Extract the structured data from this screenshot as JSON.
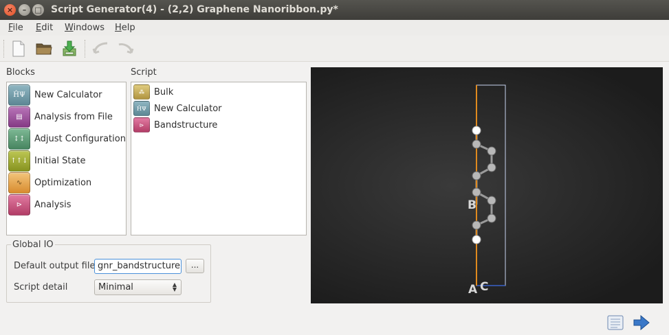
{
  "window": {
    "title": "Script Generator(4) - (2,2) Graphene Nanoribbon.py*",
    "close_glyph": "×",
    "minimize_glyph": "–",
    "maximize_glyph": "□"
  },
  "menu": {
    "items": [
      {
        "label": "File",
        "mnemonic": "F",
        "rest": "ile"
      },
      {
        "label": "Edit",
        "mnemonic": "E",
        "rest": "dit"
      },
      {
        "label": "Windows",
        "mnemonic": "W",
        "rest": "indows"
      },
      {
        "label": "Help",
        "mnemonic": "H",
        "rest": "elp"
      }
    ]
  },
  "toolbar": {
    "buttons": [
      {
        "icon": "new-file-icon"
      },
      {
        "icon": "open-folder-icon"
      },
      {
        "icon": "save-download-icon"
      },
      {
        "icon": "undo-icon",
        "disabled": true
      },
      {
        "icon": "redo-icon",
        "disabled": true
      }
    ]
  },
  "blocks": {
    "label": "Blocks",
    "items": [
      {
        "label": "New Calculator",
        "icon": "calculator-icon",
        "icon_text": "ĤΨ",
        "color": "#6f9aa7"
      },
      {
        "label": "Analysis from File",
        "icon": "file-icon",
        "icon_text": "▤",
        "color": "#9b4f9b"
      },
      {
        "label": "Adjust Configuration",
        "icon": "adjust-icon",
        "icon_text": "↕↕",
        "color": "#5a9a73"
      },
      {
        "label": "Initial State",
        "icon": "initial-state-icon",
        "icon_text": "↑↑↓",
        "color": "#9aa62f"
      },
      {
        "label": "Optimization",
        "icon": "optimization-icon",
        "icon_text": "∿",
        "color": "#e0a24a"
      },
      {
        "label": "Analysis",
        "icon": "analysis-icon",
        "icon_text": "⊳",
        "color": "#c9507a"
      }
    ]
  },
  "script": {
    "label": "Script",
    "items": [
      {
        "label": "Bulk",
        "icon": "bulk-icon",
        "icon_text": "⁂",
        "color": "#c9b05a"
      },
      {
        "label": "New Calculator",
        "icon": "calculator-icon",
        "icon_text": "ĤΨ",
        "color": "#6f9aa7"
      },
      {
        "label": "Bandstructure",
        "icon": "bandstructure-icon",
        "icon_text": "⊳",
        "color": "#c9507a"
      }
    ]
  },
  "global_io": {
    "title": "Global IO",
    "output_label": "Default output file",
    "output_value": "gnr_bandstructure.n",
    "browse_label": "...",
    "detail_label": "Script detail",
    "detail_value": "Minimal"
  },
  "viewer": {
    "axis_labels": {
      "a": "A",
      "b": "B",
      "c": "C"
    },
    "colors": {
      "a_axis": "#e08a1e",
      "cell": "#c8d4f0",
      "atom": "#bdbdbd",
      "hydrogen": "#ffffff"
    }
  },
  "bottom": {
    "buttons": [
      {
        "icon": "script-view-icon"
      },
      {
        "icon": "send-arrow-icon"
      }
    ]
  }
}
